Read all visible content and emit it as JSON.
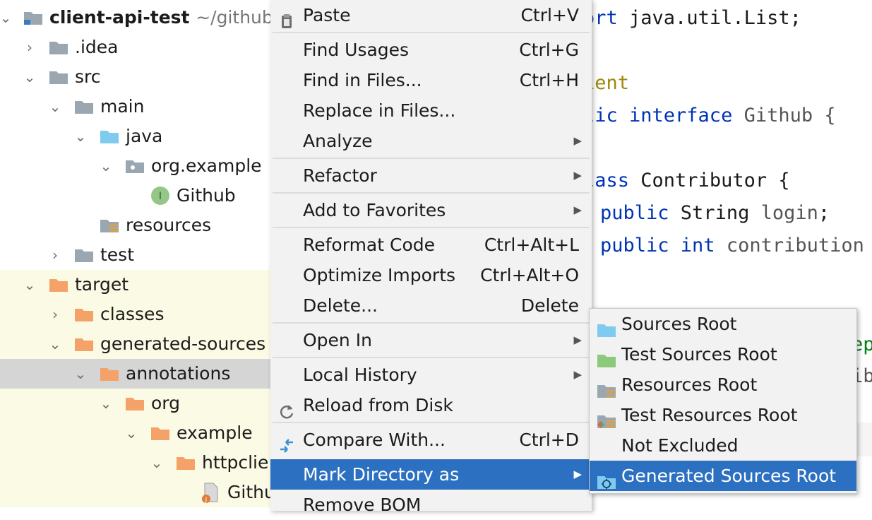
{
  "project_tree": {
    "rows": [
      {
        "label": "client-api-test",
        "path": "~/github/"
      },
      {
        "label": ".idea"
      },
      {
        "label": "src"
      },
      {
        "label": "main"
      },
      {
        "label": "java"
      },
      {
        "label": "org.example"
      },
      {
        "label": "Github"
      },
      {
        "label": "resources"
      },
      {
        "label": "test"
      },
      {
        "label": "target"
      },
      {
        "label": "classes"
      },
      {
        "label": "generated-sources"
      },
      {
        "label": "annotations"
      },
      {
        "label": "org"
      },
      {
        "label": "example"
      },
      {
        "label": "httpclie"
      },
      {
        "label": "Githu"
      }
    ]
  },
  "editor": {
    "lines": [
      {
        "kw": "ort",
        "rest": " java.util.List;"
      },
      {
        "ann": "ient"
      },
      {
        "kw": "lic interface",
        "rest": " Github {",
        "restcls": "gray"
      },
      {
        "kw": "lass",
        "rest": " Contributor {"
      },
      {
        "kw": "public",
        "rest": " String ",
        "fld": "login",
        ";": ";"
      },
      {
        "kw": "public int",
        "fld": "contribution"
      },
      {
        "grn": "ep"
      },
      {
        "gray": "ib"
      }
    ]
  },
  "context_menu": {
    "items": [
      {
        "label": "Paste",
        "shortcut": "Ctrl+V",
        "icon": "clipboard-icon"
      },
      {
        "label": "Find Usages",
        "shortcut": "Ctrl+G"
      },
      {
        "label": "Find in Files...",
        "shortcut": "Ctrl+H"
      },
      {
        "label": "Replace in Files...",
        "shortcut": ""
      },
      {
        "label": "Analyze",
        "submenu": true
      },
      {
        "label": "Refactor",
        "submenu": true
      },
      {
        "label": "Add to Favorites",
        "submenu": true
      },
      {
        "label": "Reformat Code",
        "shortcut": "Ctrl+Alt+L"
      },
      {
        "label": "Optimize Imports",
        "shortcut": "Ctrl+Alt+O"
      },
      {
        "label": "Delete...",
        "shortcut": "Delete"
      },
      {
        "label": "Open In",
        "submenu": true
      },
      {
        "label": "Local History",
        "submenu": true
      },
      {
        "label": "Reload from Disk",
        "icon": "reload-icon"
      },
      {
        "label": "Compare With...",
        "shortcut": "Ctrl+D",
        "icon": "compare-icon"
      },
      {
        "label": "Mark Directory as",
        "submenu": true,
        "active": true
      },
      {
        "label": "Remove BOM"
      }
    ]
  },
  "submenu": {
    "items": [
      {
        "label": "Sources Root",
        "icon": "sources-root-icon"
      },
      {
        "label": "Test Sources Root",
        "icon": "test-sources-root-icon"
      },
      {
        "label": "Resources Root",
        "icon": "resources-root-icon"
      },
      {
        "label": "Test Resources Root",
        "icon": "test-resources-root-icon"
      },
      {
        "label": "Not Excluded"
      },
      {
        "label": "Generated Sources Root",
        "icon": "generated-sources-root-icon",
        "active": true
      }
    ]
  },
  "colors": {
    "selection": "#2c70c1",
    "excluded_bg": "#fbfae4",
    "folder_gray": "#9aa7b0",
    "folder_orange": "#f4a268",
    "folder_blue": "#7fcbf0",
    "folder_green": "#8cc97a",
    "keyword": "#0033b3"
  }
}
